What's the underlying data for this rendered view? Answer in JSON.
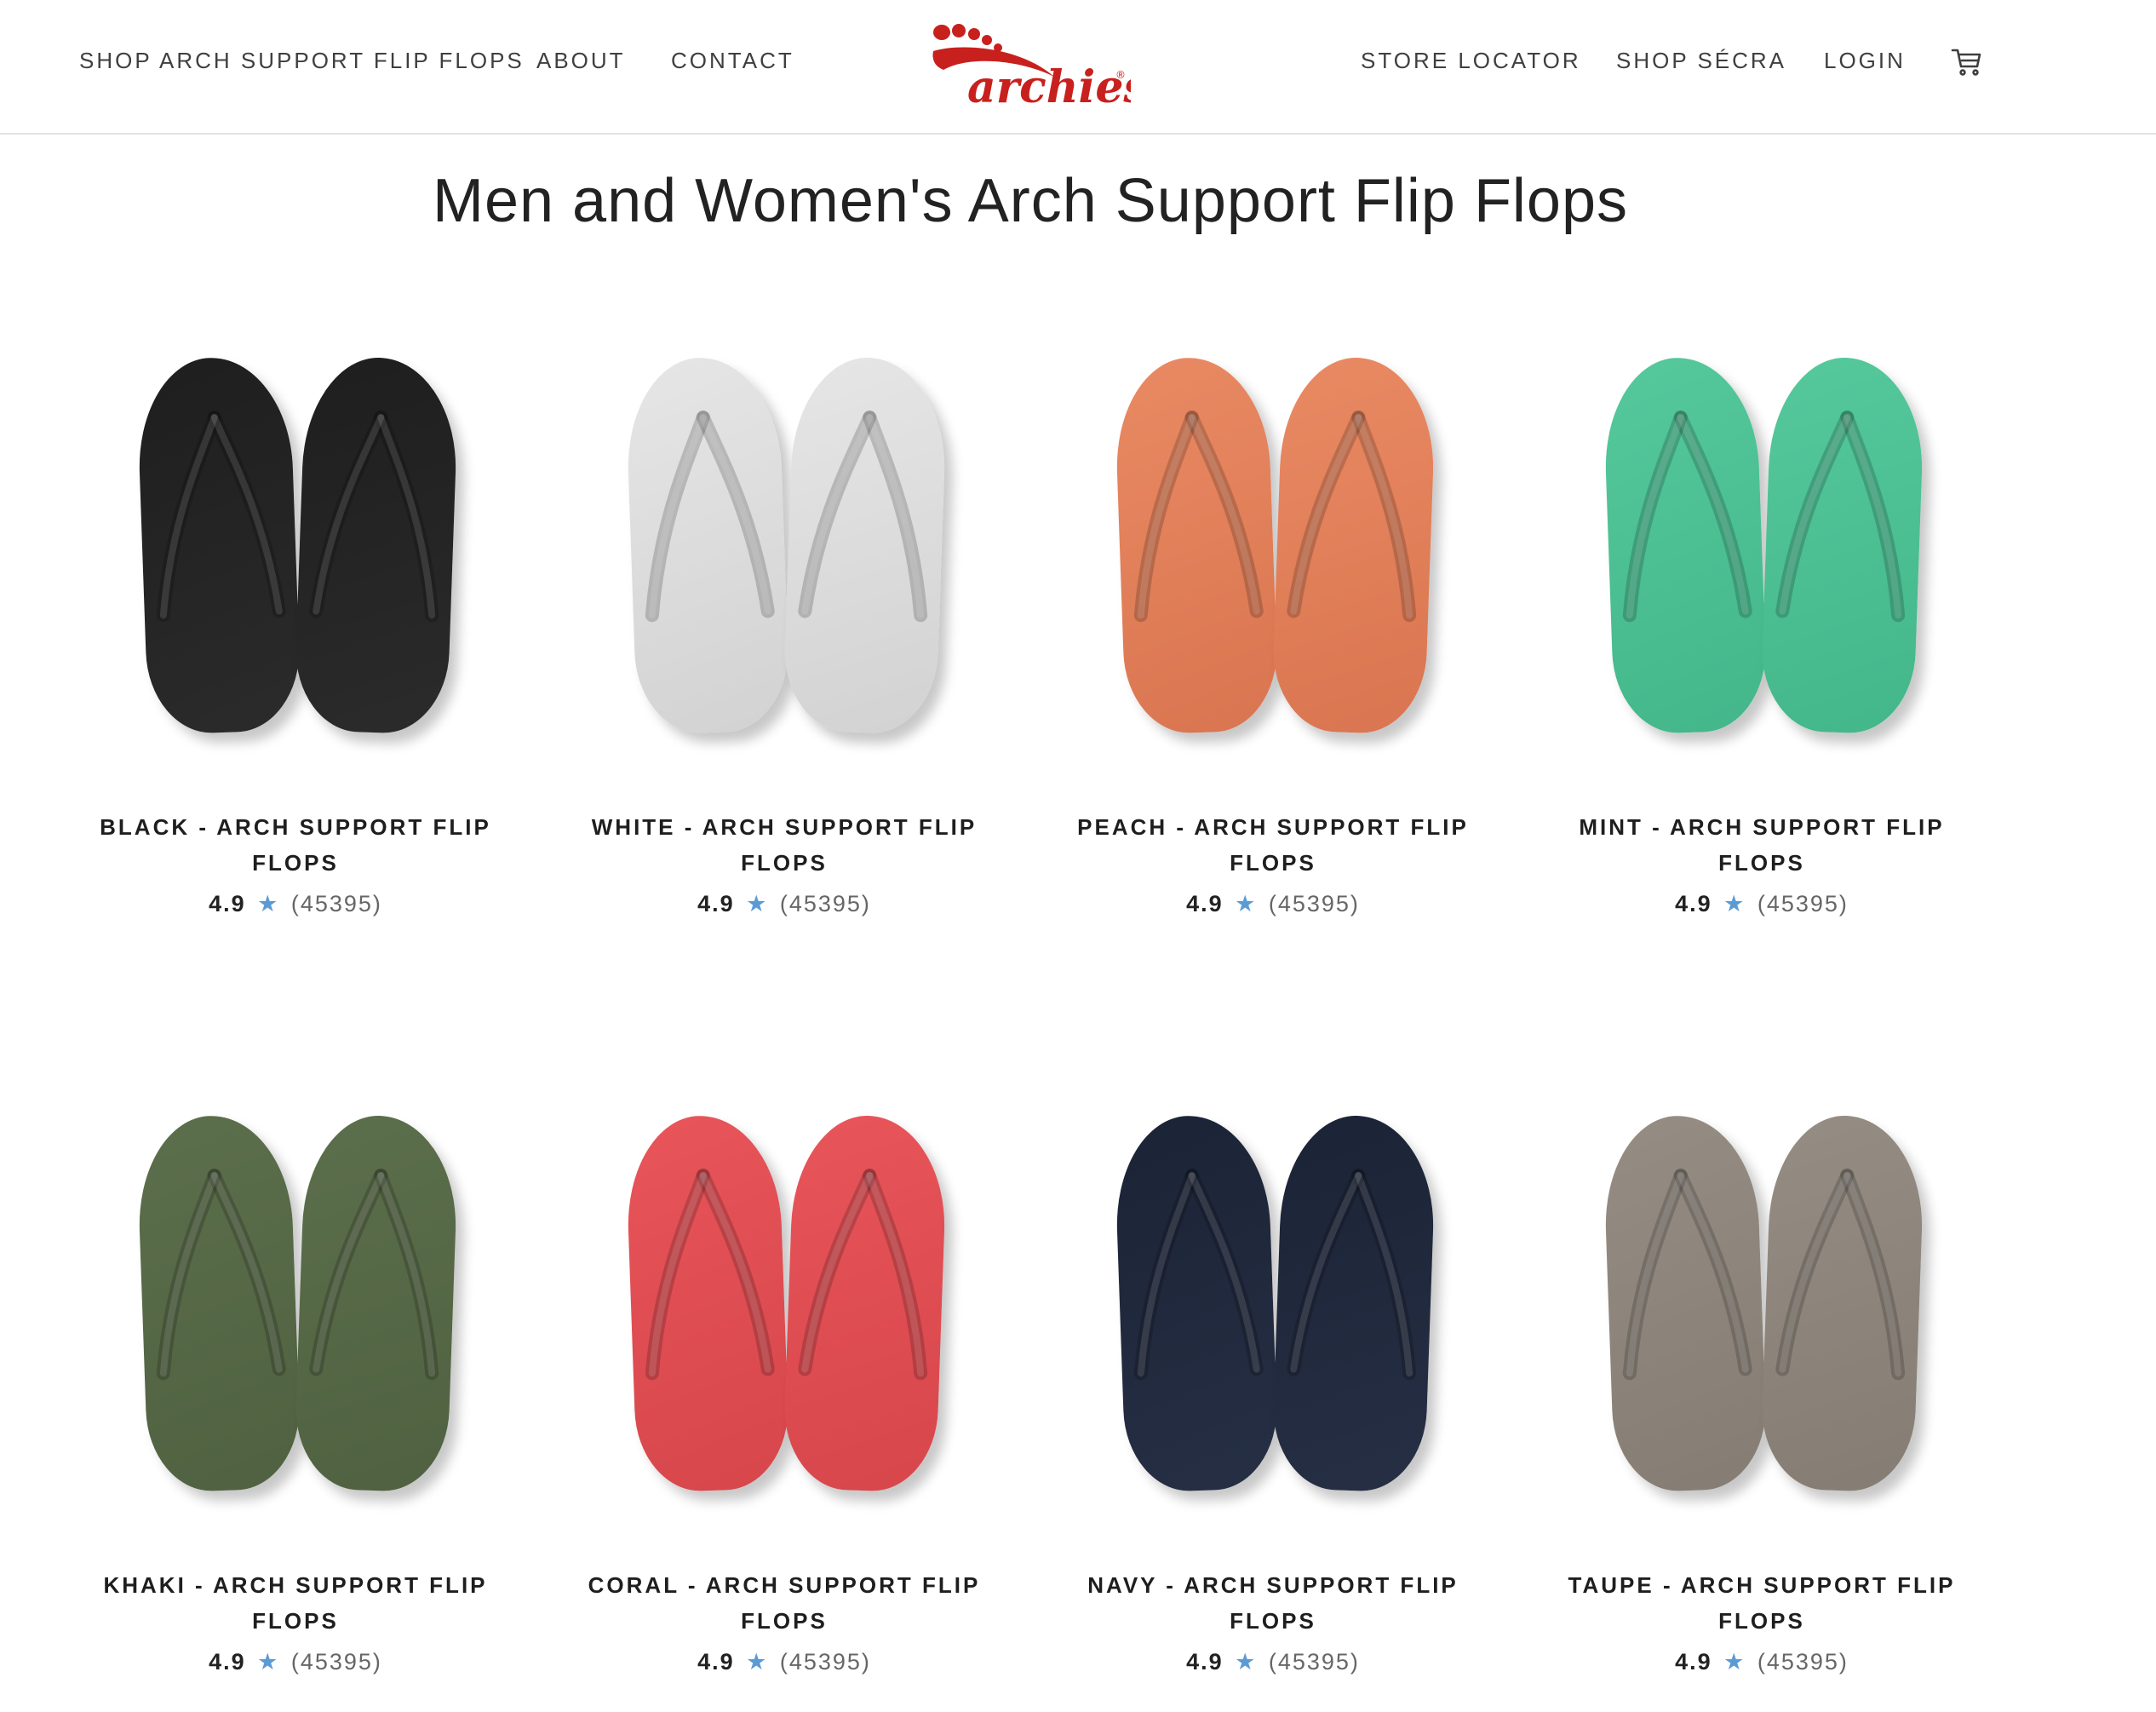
{
  "header": {
    "nav_left": [
      "SHOP ARCH SUPPORT FLIP FLOPS",
      "ABOUT",
      "CONTACT"
    ],
    "nav_right": [
      "STORE LOCATOR",
      "SHOP SÉCRA",
      "LOGIN"
    ],
    "logo_text": "archies"
  },
  "page_title": "Men and Women's Arch Support Flip Flops",
  "products": [
    {
      "name": "BLACK - ARCH SUPPORT FLIP FLOPS",
      "score": "4.9",
      "star": "★",
      "count": "(45395)",
      "color": "#1e1e1e",
      "shade": "#2b2b2b"
    },
    {
      "name": "WHITE - ARCH SUPPORT FLIP FLOPS",
      "score": "4.9",
      "star": "★",
      "count": "(45395)",
      "color": "#e6e6e6",
      "shade": "#d2d2d2"
    },
    {
      "name": "PEACH - ARCH SUPPORT FLIP FLOPS",
      "score": "4.9",
      "star": "★",
      "count": "(45395)",
      "color": "#e98a63",
      "shade": "#d97550"
    },
    {
      "name": "MINT - ARCH SUPPORT FLIP FLOPS",
      "score": "4.9",
      "star": "★",
      "count": "(45395)",
      "color": "#55c99c",
      "shade": "#43b68a"
    },
    {
      "name": "KHAKI - ARCH SUPPORT FLIP FLOPS",
      "score": "4.9",
      "star": "★",
      "count": "(45395)",
      "color": "#5c6f4c",
      "shade": "#4f6140"
    },
    {
      "name": "CORAL - ARCH SUPPORT FLIP FLOPS",
      "score": "4.9",
      "star": "★",
      "count": "(45395)",
      "color": "#e8555a",
      "shade": "#d6464b"
    },
    {
      "name": "NAVY - ARCH SUPPORT FLIP FLOPS",
      "score": "4.9",
      "star": "★",
      "count": "(45395)",
      "color": "#1b2336",
      "shade": "#262f44"
    },
    {
      "name": "TAUPE - ARCH SUPPORT FLIP FLOPS",
      "score": "4.9",
      "star": "★",
      "count": "(45395)",
      "color": "#958d83",
      "shade": "#857d73"
    }
  ],
  "colors": {
    "star": "#5b9bd5",
    "logo_red": "#c8201d"
  },
  "icons": {
    "cart": "cart-icon"
  }
}
